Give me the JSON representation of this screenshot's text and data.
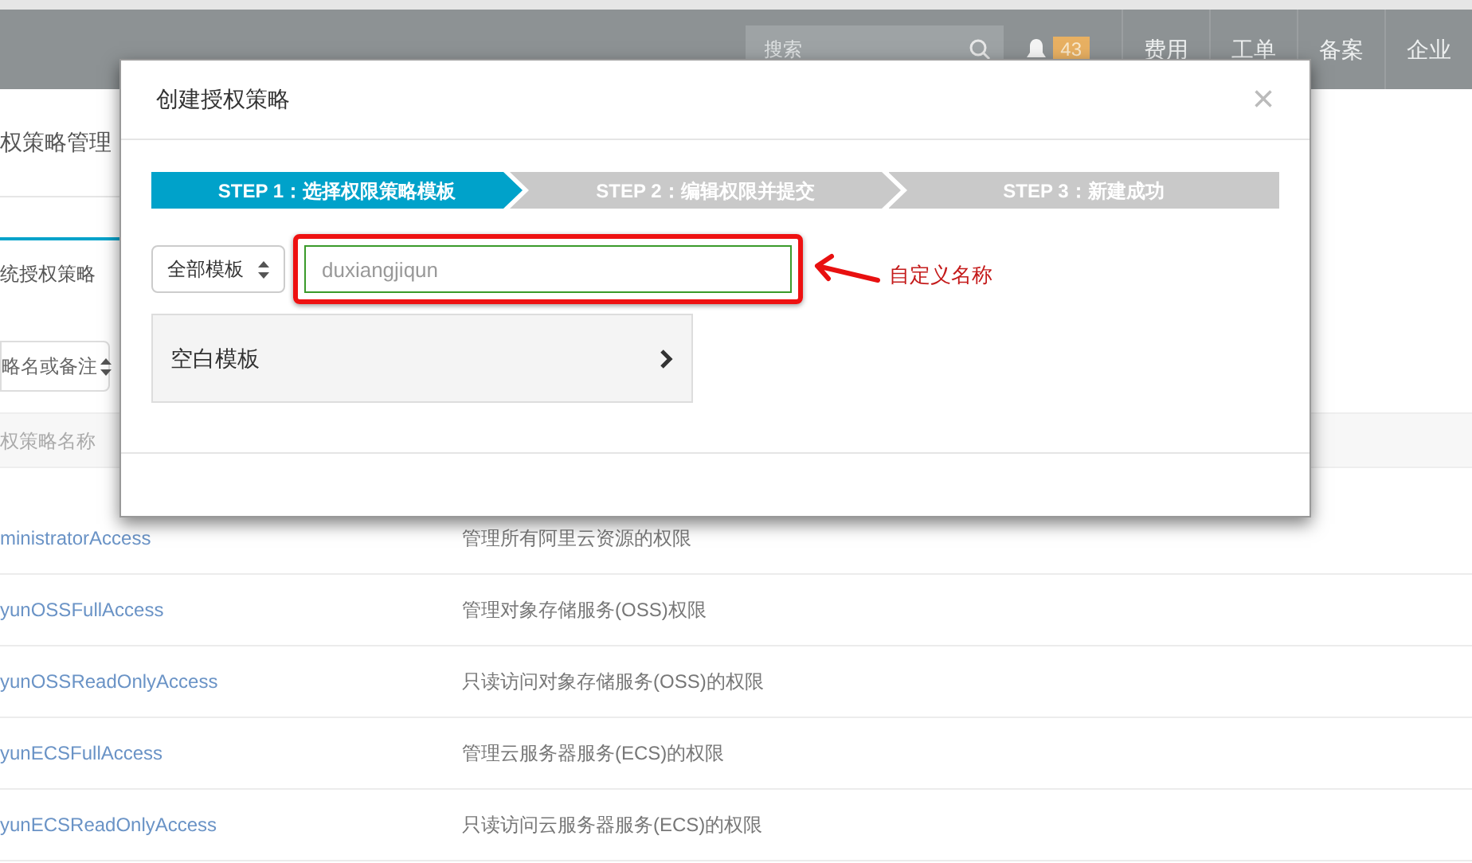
{
  "header": {
    "search": {
      "placeholder": "搜索"
    },
    "notifications": {
      "count": "43"
    },
    "nav": [
      "费用",
      "工单",
      "备案",
      "企业"
    ]
  },
  "page": {
    "title": "权策略管理",
    "tabs": [
      {
        "label": "统授权策略",
        "selected": true
      }
    ],
    "filter": {
      "value": "略名或备注"
    },
    "table": {
      "columns": [
        "权策略名称"
      ],
      "rows": [
        {
          "name": "ministratorAccess",
          "description": "管理所有阿里云资源的权限"
        },
        {
          "name": "yunOSSFullAccess",
          "description": "管理对象存储服务(OSS)权限"
        },
        {
          "name": "yunOSSReadOnlyAccess",
          "description": "只读访问对象存储服务(OSS)的权限"
        },
        {
          "name": "yunECSFullAccess",
          "description": "管理云服务器服务(ECS)的权限"
        },
        {
          "name": "yunECSReadOnlyAccess",
          "description": "只读访问云服务器服务(ECS)的权限"
        }
      ]
    }
  },
  "dialog": {
    "title": "创建授权策略",
    "close": "×",
    "steps": [
      {
        "label": "STEP 1：选择权限策略模板",
        "selected": true
      },
      {
        "label": "STEP 2：编辑权限并提交",
        "selected": false
      },
      {
        "label": "STEP 3：新建成功",
        "selected": false
      }
    ],
    "template_select": {
      "value": "全部模板"
    },
    "name_field": {
      "placeholder": "duxiangjiqun"
    },
    "templates": [
      {
        "label": "空白模板"
      }
    ],
    "annotation": {
      "label": "自定义名称"
    }
  }
}
